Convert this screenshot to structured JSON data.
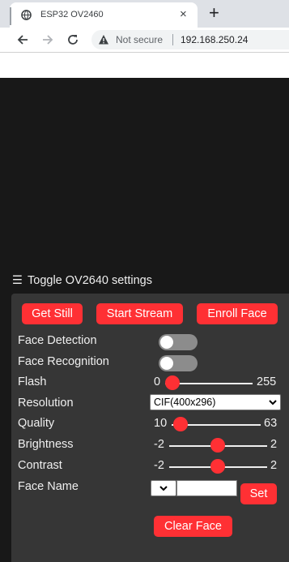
{
  "browser": {
    "tab_title": "ESP32 OV2460",
    "tab_close": "×",
    "new_tab": "+",
    "security_label": "Not secure",
    "url": "192.168.250.24"
  },
  "page": {
    "toggle_label": "Toggle OV2640 settings",
    "hamburger": "☰",
    "buttons": {
      "get_still": "Get Still",
      "start_stream": "Start Stream",
      "enroll_face": "Enroll Face",
      "set": "Set",
      "clear_face": "Clear Face"
    },
    "settings": {
      "face_detection": {
        "label": "Face Detection",
        "enabled": false
      },
      "face_recognition": {
        "label": "Face Recognition",
        "enabled": false
      },
      "flash": {
        "label": "Flash",
        "min": "0",
        "max": "255",
        "value": 0
      },
      "resolution": {
        "label": "Resolution",
        "selected": "CIF(400x296)"
      },
      "quality": {
        "label": "Quality",
        "min": "10",
        "max": "63",
        "value": 10
      },
      "brightness": {
        "label": "Brightness",
        "min": "-2",
        "max": "2",
        "value": 0
      },
      "contrast": {
        "label": "Contrast",
        "min": "-2",
        "max": "2",
        "value": 0
      },
      "face_name": {
        "label": "Face Name",
        "value": ""
      }
    }
  }
}
